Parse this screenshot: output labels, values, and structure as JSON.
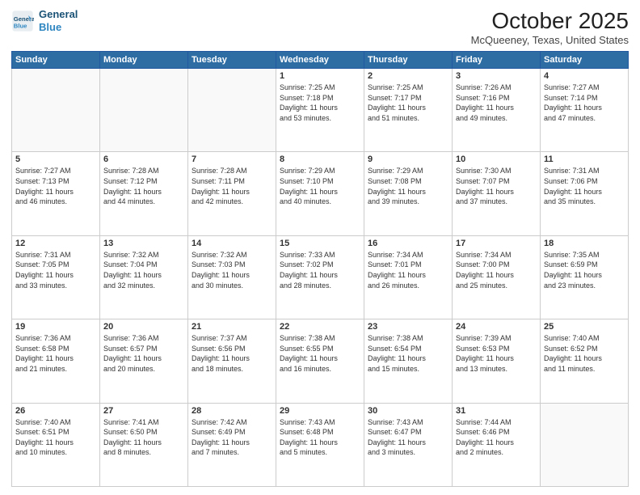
{
  "header": {
    "logo_line1": "General",
    "logo_line2": "Blue",
    "month": "October 2025",
    "location": "McQueeney, Texas, United States"
  },
  "days_of_week": [
    "Sunday",
    "Monday",
    "Tuesday",
    "Wednesday",
    "Thursday",
    "Friday",
    "Saturday"
  ],
  "weeks": [
    [
      {
        "day": "",
        "info": ""
      },
      {
        "day": "",
        "info": ""
      },
      {
        "day": "",
        "info": ""
      },
      {
        "day": "1",
        "info": "Sunrise: 7:25 AM\nSunset: 7:18 PM\nDaylight: 11 hours\nand 53 minutes."
      },
      {
        "day": "2",
        "info": "Sunrise: 7:25 AM\nSunset: 7:17 PM\nDaylight: 11 hours\nand 51 minutes."
      },
      {
        "day": "3",
        "info": "Sunrise: 7:26 AM\nSunset: 7:16 PM\nDaylight: 11 hours\nand 49 minutes."
      },
      {
        "day": "4",
        "info": "Sunrise: 7:27 AM\nSunset: 7:14 PM\nDaylight: 11 hours\nand 47 minutes."
      }
    ],
    [
      {
        "day": "5",
        "info": "Sunrise: 7:27 AM\nSunset: 7:13 PM\nDaylight: 11 hours\nand 46 minutes."
      },
      {
        "day": "6",
        "info": "Sunrise: 7:28 AM\nSunset: 7:12 PM\nDaylight: 11 hours\nand 44 minutes."
      },
      {
        "day": "7",
        "info": "Sunrise: 7:28 AM\nSunset: 7:11 PM\nDaylight: 11 hours\nand 42 minutes."
      },
      {
        "day": "8",
        "info": "Sunrise: 7:29 AM\nSunset: 7:10 PM\nDaylight: 11 hours\nand 40 minutes."
      },
      {
        "day": "9",
        "info": "Sunrise: 7:29 AM\nSunset: 7:08 PM\nDaylight: 11 hours\nand 39 minutes."
      },
      {
        "day": "10",
        "info": "Sunrise: 7:30 AM\nSunset: 7:07 PM\nDaylight: 11 hours\nand 37 minutes."
      },
      {
        "day": "11",
        "info": "Sunrise: 7:31 AM\nSunset: 7:06 PM\nDaylight: 11 hours\nand 35 minutes."
      }
    ],
    [
      {
        "day": "12",
        "info": "Sunrise: 7:31 AM\nSunset: 7:05 PM\nDaylight: 11 hours\nand 33 minutes."
      },
      {
        "day": "13",
        "info": "Sunrise: 7:32 AM\nSunset: 7:04 PM\nDaylight: 11 hours\nand 32 minutes."
      },
      {
        "day": "14",
        "info": "Sunrise: 7:32 AM\nSunset: 7:03 PM\nDaylight: 11 hours\nand 30 minutes."
      },
      {
        "day": "15",
        "info": "Sunrise: 7:33 AM\nSunset: 7:02 PM\nDaylight: 11 hours\nand 28 minutes."
      },
      {
        "day": "16",
        "info": "Sunrise: 7:34 AM\nSunset: 7:01 PM\nDaylight: 11 hours\nand 26 minutes."
      },
      {
        "day": "17",
        "info": "Sunrise: 7:34 AM\nSunset: 7:00 PM\nDaylight: 11 hours\nand 25 minutes."
      },
      {
        "day": "18",
        "info": "Sunrise: 7:35 AM\nSunset: 6:59 PM\nDaylight: 11 hours\nand 23 minutes."
      }
    ],
    [
      {
        "day": "19",
        "info": "Sunrise: 7:36 AM\nSunset: 6:58 PM\nDaylight: 11 hours\nand 21 minutes."
      },
      {
        "day": "20",
        "info": "Sunrise: 7:36 AM\nSunset: 6:57 PM\nDaylight: 11 hours\nand 20 minutes."
      },
      {
        "day": "21",
        "info": "Sunrise: 7:37 AM\nSunset: 6:56 PM\nDaylight: 11 hours\nand 18 minutes."
      },
      {
        "day": "22",
        "info": "Sunrise: 7:38 AM\nSunset: 6:55 PM\nDaylight: 11 hours\nand 16 minutes."
      },
      {
        "day": "23",
        "info": "Sunrise: 7:38 AM\nSunset: 6:54 PM\nDaylight: 11 hours\nand 15 minutes."
      },
      {
        "day": "24",
        "info": "Sunrise: 7:39 AM\nSunset: 6:53 PM\nDaylight: 11 hours\nand 13 minutes."
      },
      {
        "day": "25",
        "info": "Sunrise: 7:40 AM\nSunset: 6:52 PM\nDaylight: 11 hours\nand 11 minutes."
      }
    ],
    [
      {
        "day": "26",
        "info": "Sunrise: 7:40 AM\nSunset: 6:51 PM\nDaylight: 11 hours\nand 10 minutes."
      },
      {
        "day": "27",
        "info": "Sunrise: 7:41 AM\nSunset: 6:50 PM\nDaylight: 11 hours\nand 8 minutes."
      },
      {
        "day": "28",
        "info": "Sunrise: 7:42 AM\nSunset: 6:49 PM\nDaylight: 11 hours\nand 7 minutes."
      },
      {
        "day": "29",
        "info": "Sunrise: 7:43 AM\nSunset: 6:48 PM\nDaylight: 11 hours\nand 5 minutes."
      },
      {
        "day": "30",
        "info": "Sunrise: 7:43 AM\nSunset: 6:47 PM\nDaylight: 11 hours\nand 3 minutes."
      },
      {
        "day": "31",
        "info": "Sunrise: 7:44 AM\nSunset: 6:46 PM\nDaylight: 11 hours\nand 2 minutes."
      },
      {
        "day": "",
        "info": ""
      }
    ]
  ]
}
